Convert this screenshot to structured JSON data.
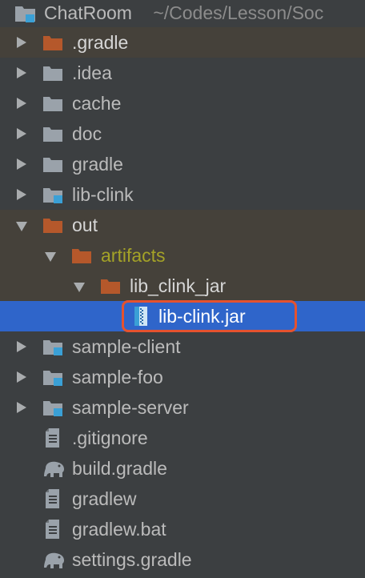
{
  "project": {
    "name": "ChatRoom",
    "path": "~/Codes/Lesson/Soc"
  },
  "items": {
    "gradle_hidden": ".gradle",
    "idea": ".idea",
    "cache": "cache",
    "doc": "doc",
    "gradle": "gradle",
    "lib_clink": "lib-clink",
    "out": "out",
    "artifacts": "artifacts",
    "lib_clink_jar": "lib_clink_jar",
    "lib_clink_jar_file": "lib-clink.jar",
    "sample_client": "sample-client",
    "sample_foo": "sample-foo",
    "sample_server": "sample-server",
    "gitignore": ".gitignore",
    "build_gradle": "build.gradle",
    "gradlew": "gradlew",
    "gradlew_bat": "gradlew.bat",
    "settings_gradle": "settings.gradle"
  },
  "colors": {
    "background": "#3c3f41",
    "excluded_row": "#45413a",
    "selected_row": "#2f65ca",
    "excluded_folder": "#b5582b",
    "folder": "#9aa2aa",
    "module_badge": "#3aa0d6",
    "artifact_text": "#a4a227",
    "highlight_box": "#e5522f"
  },
  "icons": {
    "project": "module-folder-icon",
    "folder": "folder-icon",
    "excluded_folder": "excluded-folder-icon",
    "module": "module-folder-icon",
    "jar": "jar-archive-icon",
    "text_file": "text-file-icon",
    "gradle": "gradle-elephant-icon"
  }
}
